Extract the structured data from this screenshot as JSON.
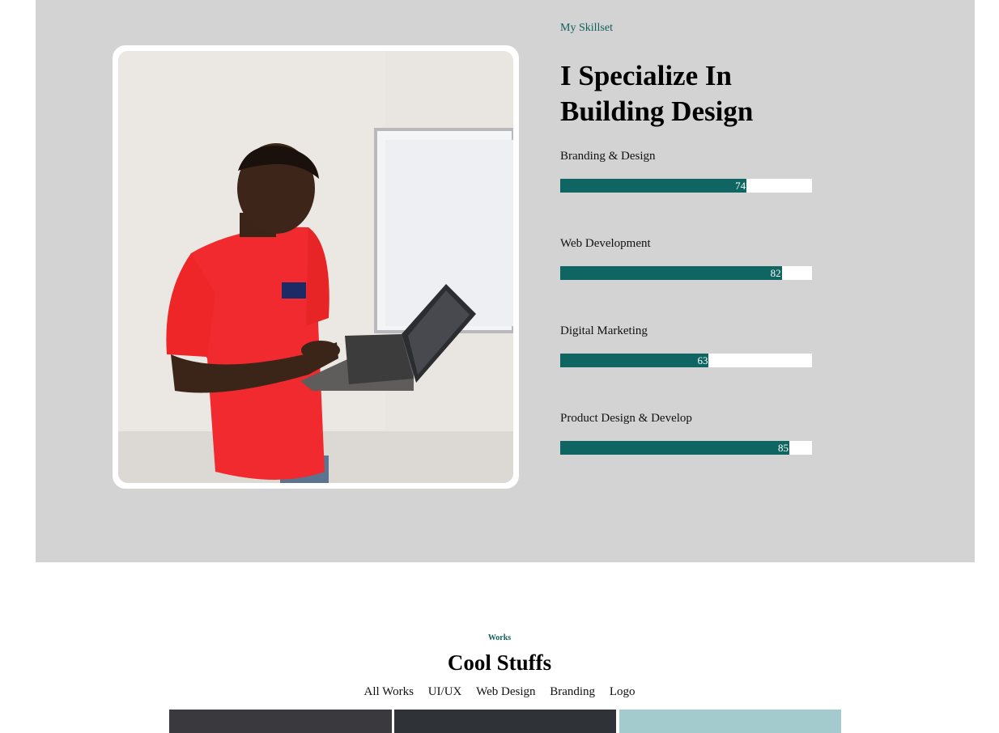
{
  "skills": {
    "eyebrow": "My Skillset",
    "heading_line1": "I Specialize In",
    "heading_line2": "Building Design",
    "items": [
      {
        "label": "Branding & Design",
        "value": "74",
        "percent": 74
      },
      {
        "label": "Web Development",
        "value": "82",
        "percent": 88
      },
      {
        "label": "Digital Marketing",
        "value": "63",
        "percent": 59
      },
      {
        "label": "Product Design & Develop",
        "value": "85",
        "percent": 91
      }
    ],
    "colors": {
      "section_bg": "#d3d3d3",
      "accent": "#0e6561",
      "track": "#ffffff"
    }
  },
  "works": {
    "eyebrow": "Works",
    "title": "Cool Stuffs",
    "filters": [
      "All Works",
      "UI/UX",
      "Web Design",
      "Branding",
      "Logo"
    ],
    "thumb_colors": [
      "#3a3a3e",
      "#2f3236",
      "#a3cacc"
    ]
  }
}
